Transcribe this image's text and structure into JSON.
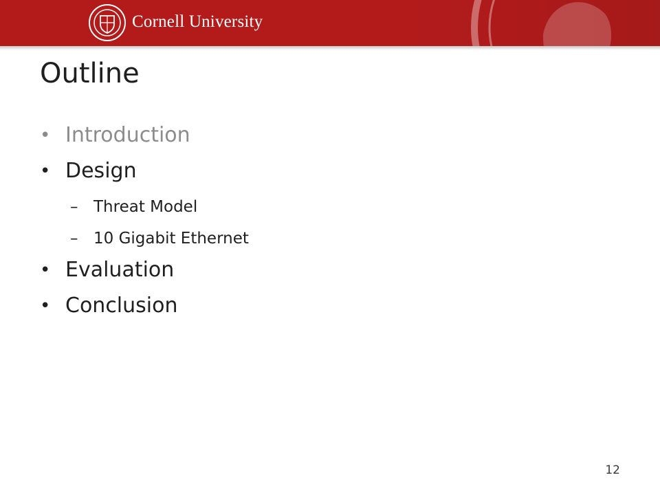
{
  "header": {
    "brand_name": "Cornell University",
    "seal_icon": "cornell-seal-icon",
    "bg_color": "#b31b1b"
  },
  "slide": {
    "title": "Outline",
    "items": [
      {
        "label": "Introduction",
        "state": "dimmed"
      },
      {
        "label": "Design",
        "state": "normal",
        "subitems": [
          "Threat Model",
          "10 Gigabit Ethernet"
        ]
      },
      {
        "label": "Evaluation",
        "state": "normal"
      },
      {
        "label": "Conclusion",
        "state": "normal"
      }
    ],
    "page_number": "12"
  }
}
